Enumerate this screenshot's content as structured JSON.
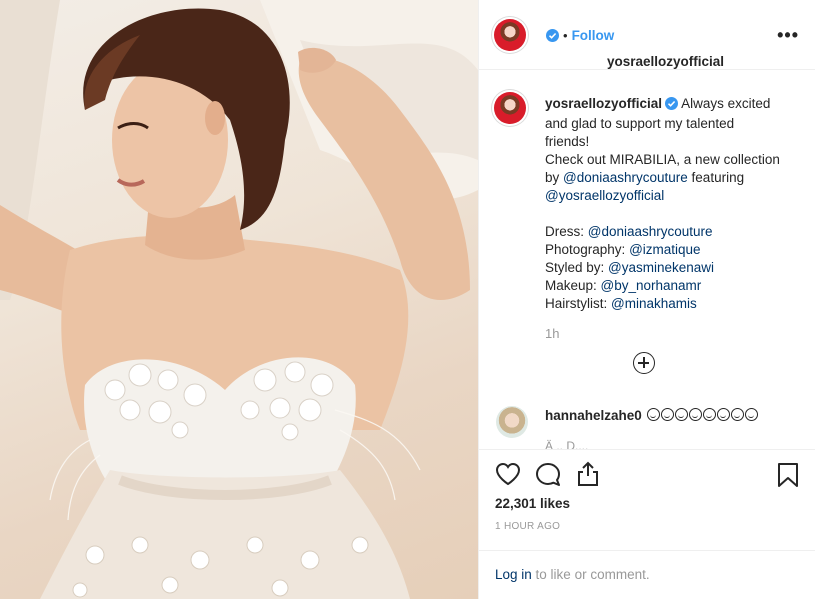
{
  "post": {
    "username": "yosraellozyofficial",
    "follow_label": "Follow",
    "more_label": "•••"
  },
  "caption": {
    "username": "yosraellozyofficial",
    "lines": [
      "Always excited",
      "and glad to support my talented",
      "friends!",
      "Check out MIRABILIA, a new collection",
      "by ",
      "@doniaashrycouture",
      " featuring",
      "@yosraellozyofficial",
      "Dress: ",
      "@doniaashrycouture",
      "Photography: ",
      "@izmatique",
      "Styled by: ",
      "@yasminekenawi",
      "Makeup: ",
      "@by_norhanamr",
      "Hairstylist: ",
      "@minakhamis"
    ],
    "time": "1h"
  },
  "comment": {
    "username": "hannahelzahe0",
    "emoji_count": 8,
    "truncated_text": "Ä .. D...."
  },
  "actions": {
    "likes": "22,301 likes",
    "ago": "1 HOUR AGO",
    "login_link": "Log in",
    "login_rest": " to like or comment."
  },
  "colors": {
    "link": "#3897f0",
    "mention": "#003569",
    "text": "#262626",
    "muted": "#999999"
  },
  "icons": [
    "verified-badge-icon",
    "more-options-icon",
    "load-more-icon",
    "heart-icon",
    "comment-icon",
    "share-icon",
    "bookmark-icon"
  ]
}
